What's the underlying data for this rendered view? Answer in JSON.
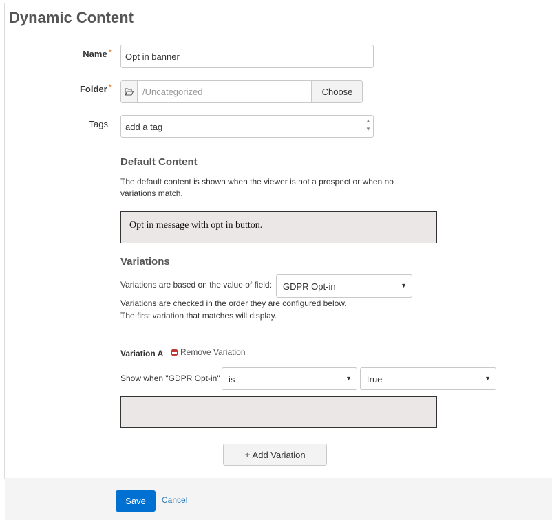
{
  "page": {
    "title": "Dynamic Content"
  },
  "form": {
    "name": {
      "label": "Name",
      "required_mark": "*",
      "value": "Opt in banner"
    },
    "folder": {
      "label": "Folder",
      "required_mark": "*",
      "path": "/Uncategorized",
      "choose_label": "Choose",
      "icon": "folder-open-icon"
    },
    "tags": {
      "label": "Tags",
      "placeholder": "add a tag"
    }
  },
  "default_content": {
    "heading": "Default Content",
    "help": "The default content is shown when the viewer is not a prospect or when no variations match.",
    "body": "Opt in message with opt in button."
  },
  "variations": {
    "heading": "Variations",
    "based_on_label": "Variations are based on the value of field:",
    "field_value": "GDPR Opt-in",
    "help_line1": "Variations are checked in the order they are configured below.",
    "help_line2": "The first variation that matches will display.",
    "items": [
      {
        "title": "Variation A",
        "remove_label": "Remove Variation",
        "show_when_label": "Show when \"GDPR Opt-in\"",
        "operator": "is",
        "value": "true",
        "body": ""
      }
    ],
    "add_label": "Add Variation"
  },
  "footer": {
    "save_label": "Save",
    "cancel_label": "Cancel"
  },
  "colors": {
    "accent": "#0070d2",
    "required": "#e8701a",
    "remove": "#c23934",
    "editor_bg": "#ece7e7"
  }
}
